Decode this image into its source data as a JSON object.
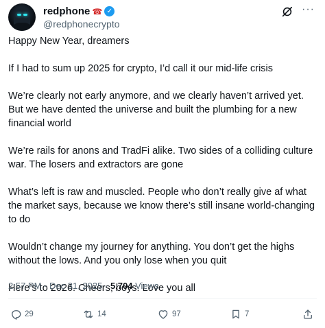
{
  "header": {
    "display_name": "redphone",
    "handle": "@redphonecrypto",
    "verified": true,
    "name_emoji_icon": "telephone-icon"
  },
  "tweet": {
    "paragraphs": [
      "Happy New Year, dreamers",
      "If I had to sum up 2025 for crypto, I’d call it our mid-life crisis",
      "We’re clearly not early anymore, and we clearly haven’t arrived yet. But we have dented the universe and built the plumbing for a new financial world",
      "We’re rails for anons and TradFi alike. Two sides of a colliding culture war. The losers and extractors are gone",
      "What’s left is raw and muscled. People who don’t really give af what the market says, because we know there’s still insane world-changing to do",
      "Wouldn’t change my journey for anything. You don’t get the highs without the lows. And you only lose when you quit",
      "Here’s to 2026. Cheers, boys. Love you all"
    ]
  },
  "meta": {
    "time": "2:57 PM",
    "separator": "·",
    "date": "Dec 31, 2025",
    "views_count": "5,704",
    "views_label": "Views"
  },
  "actions": {
    "replies": "29",
    "reposts": "14",
    "likes": "97",
    "bookmarks": "7"
  },
  "colors": {
    "text": "#0f1419",
    "secondary": "#536471",
    "verified": "#1d9bf0",
    "divider": "#eff3f4"
  }
}
